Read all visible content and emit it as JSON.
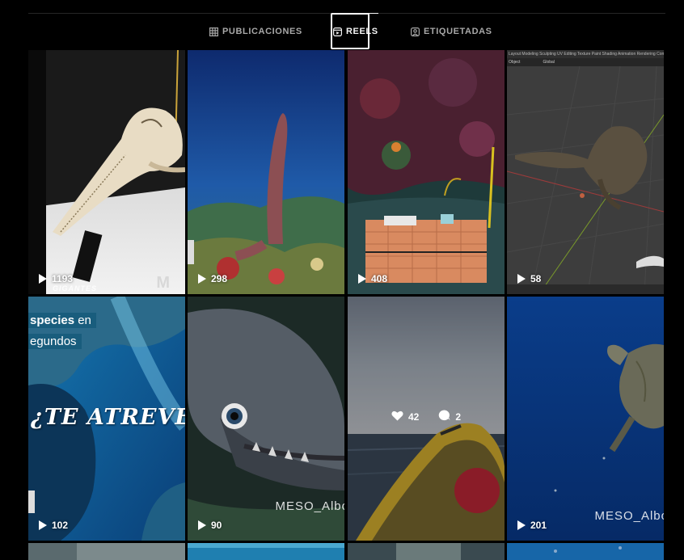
{
  "tabs": [
    {
      "label": "PUBLICACIONES",
      "icon": "grid-icon",
      "active": false
    },
    {
      "label": "REELS",
      "icon": "reels-icon",
      "active": true
    },
    {
      "label": "ETIQUETADAS",
      "icon": "tagged-icon",
      "active": false
    }
  ],
  "reels": [
    {
      "views": "1193",
      "watermark": "GIGANTES",
      "scene": "dolphin-skull"
    },
    {
      "views": "298",
      "scene": "sea-cucumber"
    },
    {
      "views": "408",
      "scene": "underwater-box"
    },
    {
      "views": "58",
      "scene": "blender-3d-skull",
      "app_bar": "Layout   Modeling   Sculpting   UV Editing   Texture Paint   Shading   Animation   Rendering   Compositing   Scripting",
      "mode_label": "Object",
      "orient_label": "Global"
    },
    {
      "views": "102",
      "caption_line1_highlight": "species",
      "caption_line1_rest": " en",
      "caption_line2": "egundos",
      "headline": "¿TE ATREVES?",
      "scene": "underwater-cave"
    },
    {
      "views": "90",
      "watermark": "MESO_Albo",
      "scene": "moray-eel"
    },
    {
      "likes": "42",
      "comments": "2",
      "scene": "boat-sea",
      "hovered": true
    },
    {
      "views": "201",
      "watermark": "MESO_Albo",
      "scene": "sea-turtle"
    }
  ],
  "colors": {
    "background": "#000000",
    "tab_active": "#f5f5f5",
    "tab_inactive": "#a8a8a8"
  }
}
